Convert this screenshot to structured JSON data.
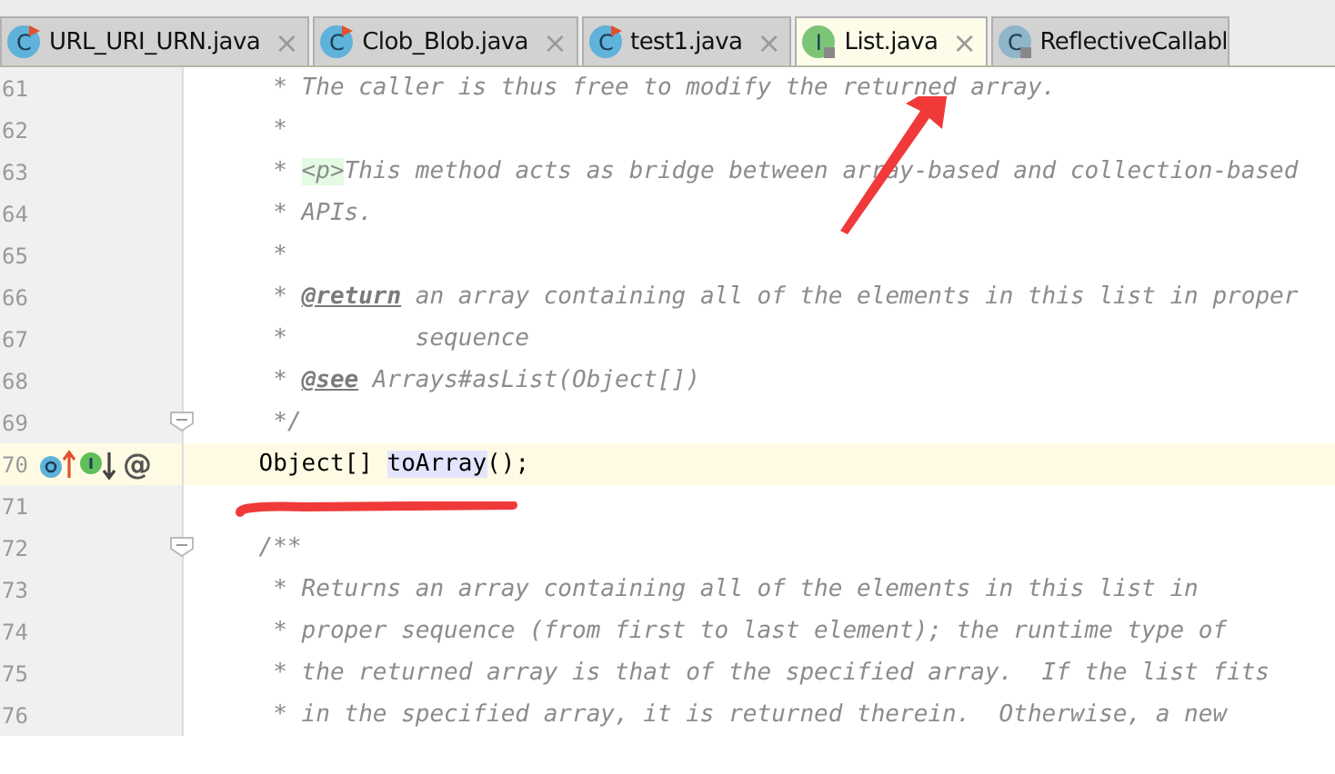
{
  "tabs": [
    {
      "label": "URL_URI_URN.java",
      "badge": "C",
      "kind": "class",
      "selected": false,
      "closable": true
    },
    {
      "label": "Clob_Blob.java",
      "badge": "C",
      "kind": "class",
      "selected": false,
      "closable": true
    },
    {
      "label": "test1.java",
      "badge": "C",
      "kind": "class",
      "selected": false,
      "closable": true
    },
    {
      "label": "List.java",
      "badge": "I",
      "kind": "interface",
      "selected": true,
      "closable": true
    },
    {
      "label": "ReflectiveCallabl",
      "badge": "C",
      "kind": "locked-class",
      "selected": false,
      "closable": false
    }
  ],
  "close_glyph": "×",
  "lines": [
    {
      "number": "61",
      "current": false,
      "segments": [
        {
          "kind": "comment",
          "text": "     * The caller is thus free to modify the returned array."
        }
      ]
    },
    {
      "number": "62",
      "current": false,
      "segments": [
        {
          "kind": "comment",
          "text": "     *"
        }
      ]
    },
    {
      "number": "63",
      "current": false,
      "segments": [
        {
          "kind": "comment",
          "text": "     * "
        },
        {
          "kind": "html-tag",
          "text": "<p>"
        },
        {
          "kind": "comment",
          "text": "This method acts as bridge between array-based and collection-based"
        }
      ]
    },
    {
      "number": "64",
      "current": false,
      "segments": [
        {
          "kind": "comment",
          "text": "     * APIs."
        }
      ]
    },
    {
      "number": "65",
      "current": false,
      "segments": [
        {
          "kind": "comment",
          "text": "     *"
        }
      ]
    },
    {
      "number": "66",
      "current": false,
      "segments": [
        {
          "kind": "comment",
          "text": "     * "
        },
        {
          "kind": "doc-tag",
          "text": "@return"
        },
        {
          "kind": "comment",
          "text": " an array containing all of the elements in this list in proper"
        }
      ]
    },
    {
      "number": "67",
      "current": false,
      "segments": [
        {
          "kind": "comment",
          "text": "     *         sequence"
        }
      ]
    },
    {
      "number": "68",
      "current": false,
      "segments": [
        {
          "kind": "comment",
          "text": "     * "
        },
        {
          "kind": "doc-tag",
          "text": "@see"
        },
        {
          "kind": "comment",
          "text": " Arrays#asList(Object[])"
        }
      ]
    },
    {
      "number": "69",
      "current": false,
      "fold": true,
      "segments": [
        {
          "kind": "comment",
          "text": "     */"
        }
      ]
    },
    {
      "number": "70",
      "current": true,
      "annotation_glyph": "@",
      "segments": [
        {
          "kind": "code",
          "text": "    Object[] "
        },
        {
          "kind": "usage",
          "text": "toArray"
        },
        {
          "kind": "code",
          "text": "();"
        }
      ]
    },
    {
      "number": "71",
      "current": false
    },
    {
      "number": "72",
      "current": false,
      "fold": true,
      "segments": [
        {
          "kind": "comment",
          "text": "    /**"
        }
      ]
    },
    {
      "number": "73",
      "current": false,
      "segments": [
        {
          "kind": "comment",
          "text": "     * Returns an array containing all of the elements in this list in"
        }
      ]
    },
    {
      "number": "74",
      "current": false,
      "segments": [
        {
          "kind": "comment",
          "text": "     * proper sequence (from first to last element); the runtime type of"
        }
      ]
    },
    {
      "number": "75",
      "current": false,
      "segments": [
        {
          "kind": "comment",
          "text": "     * the returned array is that of the specified array.  If the list fits"
        }
      ]
    },
    {
      "number": "76",
      "current": false,
      "segments": [
        {
          "kind": "comment",
          "text": "     * in the specified array, it is returned therein.  Otherwise, a new"
        }
      ]
    }
  ]
}
